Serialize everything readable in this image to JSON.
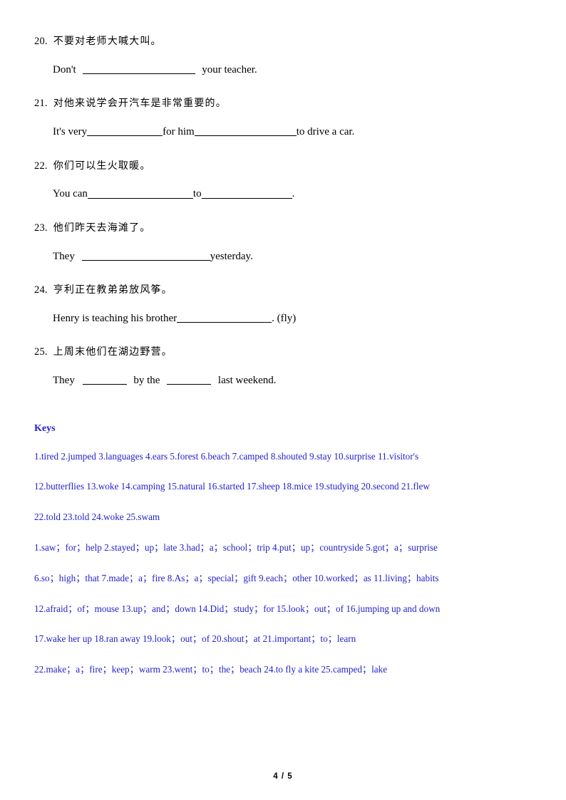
{
  "document": {
    "page_footer": "4 / 5"
  },
  "exercises": [
    {
      "number": "20.",
      "prompt_cn": "不要对老师大喊大叫。",
      "answer_parts": [
        "Don't ",
        " your teacher."
      ]
    },
    {
      "number": "21.",
      "prompt_cn": "对他来说学会开汽车是非常重要的。",
      "answer_parts": [
        "It's very",
        "for him",
        "to drive a car."
      ]
    },
    {
      "number": "22.",
      "prompt_cn": "你们可以生火取暖。",
      "answer_parts": [
        "You can",
        "to",
        "."
      ]
    },
    {
      "number": "23.",
      "prompt_cn": "他们昨天去海滩了。",
      "answer_parts": [
        "They ",
        "yesterday."
      ]
    },
    {
      "number": "24.",
      "prompt_cn": "亨利正在教弟弟放风筝。",
      "answer_parts": [
        "Henry is teaching his brother",
        ". (fly)"
      ]
    },
    {
      "number": "25.",
      "prompt_cn": "上周末他们在湖边野营。",
      "answer_parts": [
        "They ",
        " by the ",
        " last weekend."
      ]
    }
  ],
  "keys": {
    "heading": "Keys",
    "group_one": [
      "1.tired 2.jumped 3.languages 4.ears 5.forest 6.beach 7.camped 8.shouted 9.stay 10.surprise 11.visitor's",
      "12.butterflies 13.woke 14.camping 15.natural 16.started 17.sheep 18.mice 19.studying 20.second 21.flew",
      "22.told 23.told 24.woke 25.swam"
    ],
    "group_two": [
      "1.saw；for；help 2.stayed；up；late 3.had；a；school；trip 4.put；up；countryside 5.got；a；surprise",
      "6.so；high；that 7.made；a；fire 8.As；a；special；gift 9.each；other 10.worked；as 11.living；habits",
      "12.afraid；of；mouse 13.up；and；down 14.Did；study；for 15.look；out；of 16.jumping up and down",
      "17.wake her up 18.ran away 19.look；out；of 20.shout；at 21.important；to；learn",
      "22.make；a；fire；keep；warm 23.went；to；the；beach 24.to fly a kite 25.camped；lake"
    ]
  },
  "colors": {
    "keys_blue": "#2222cc",
    "body_black": "#000000",
    "page_background": "#ffffff"
  }
}
